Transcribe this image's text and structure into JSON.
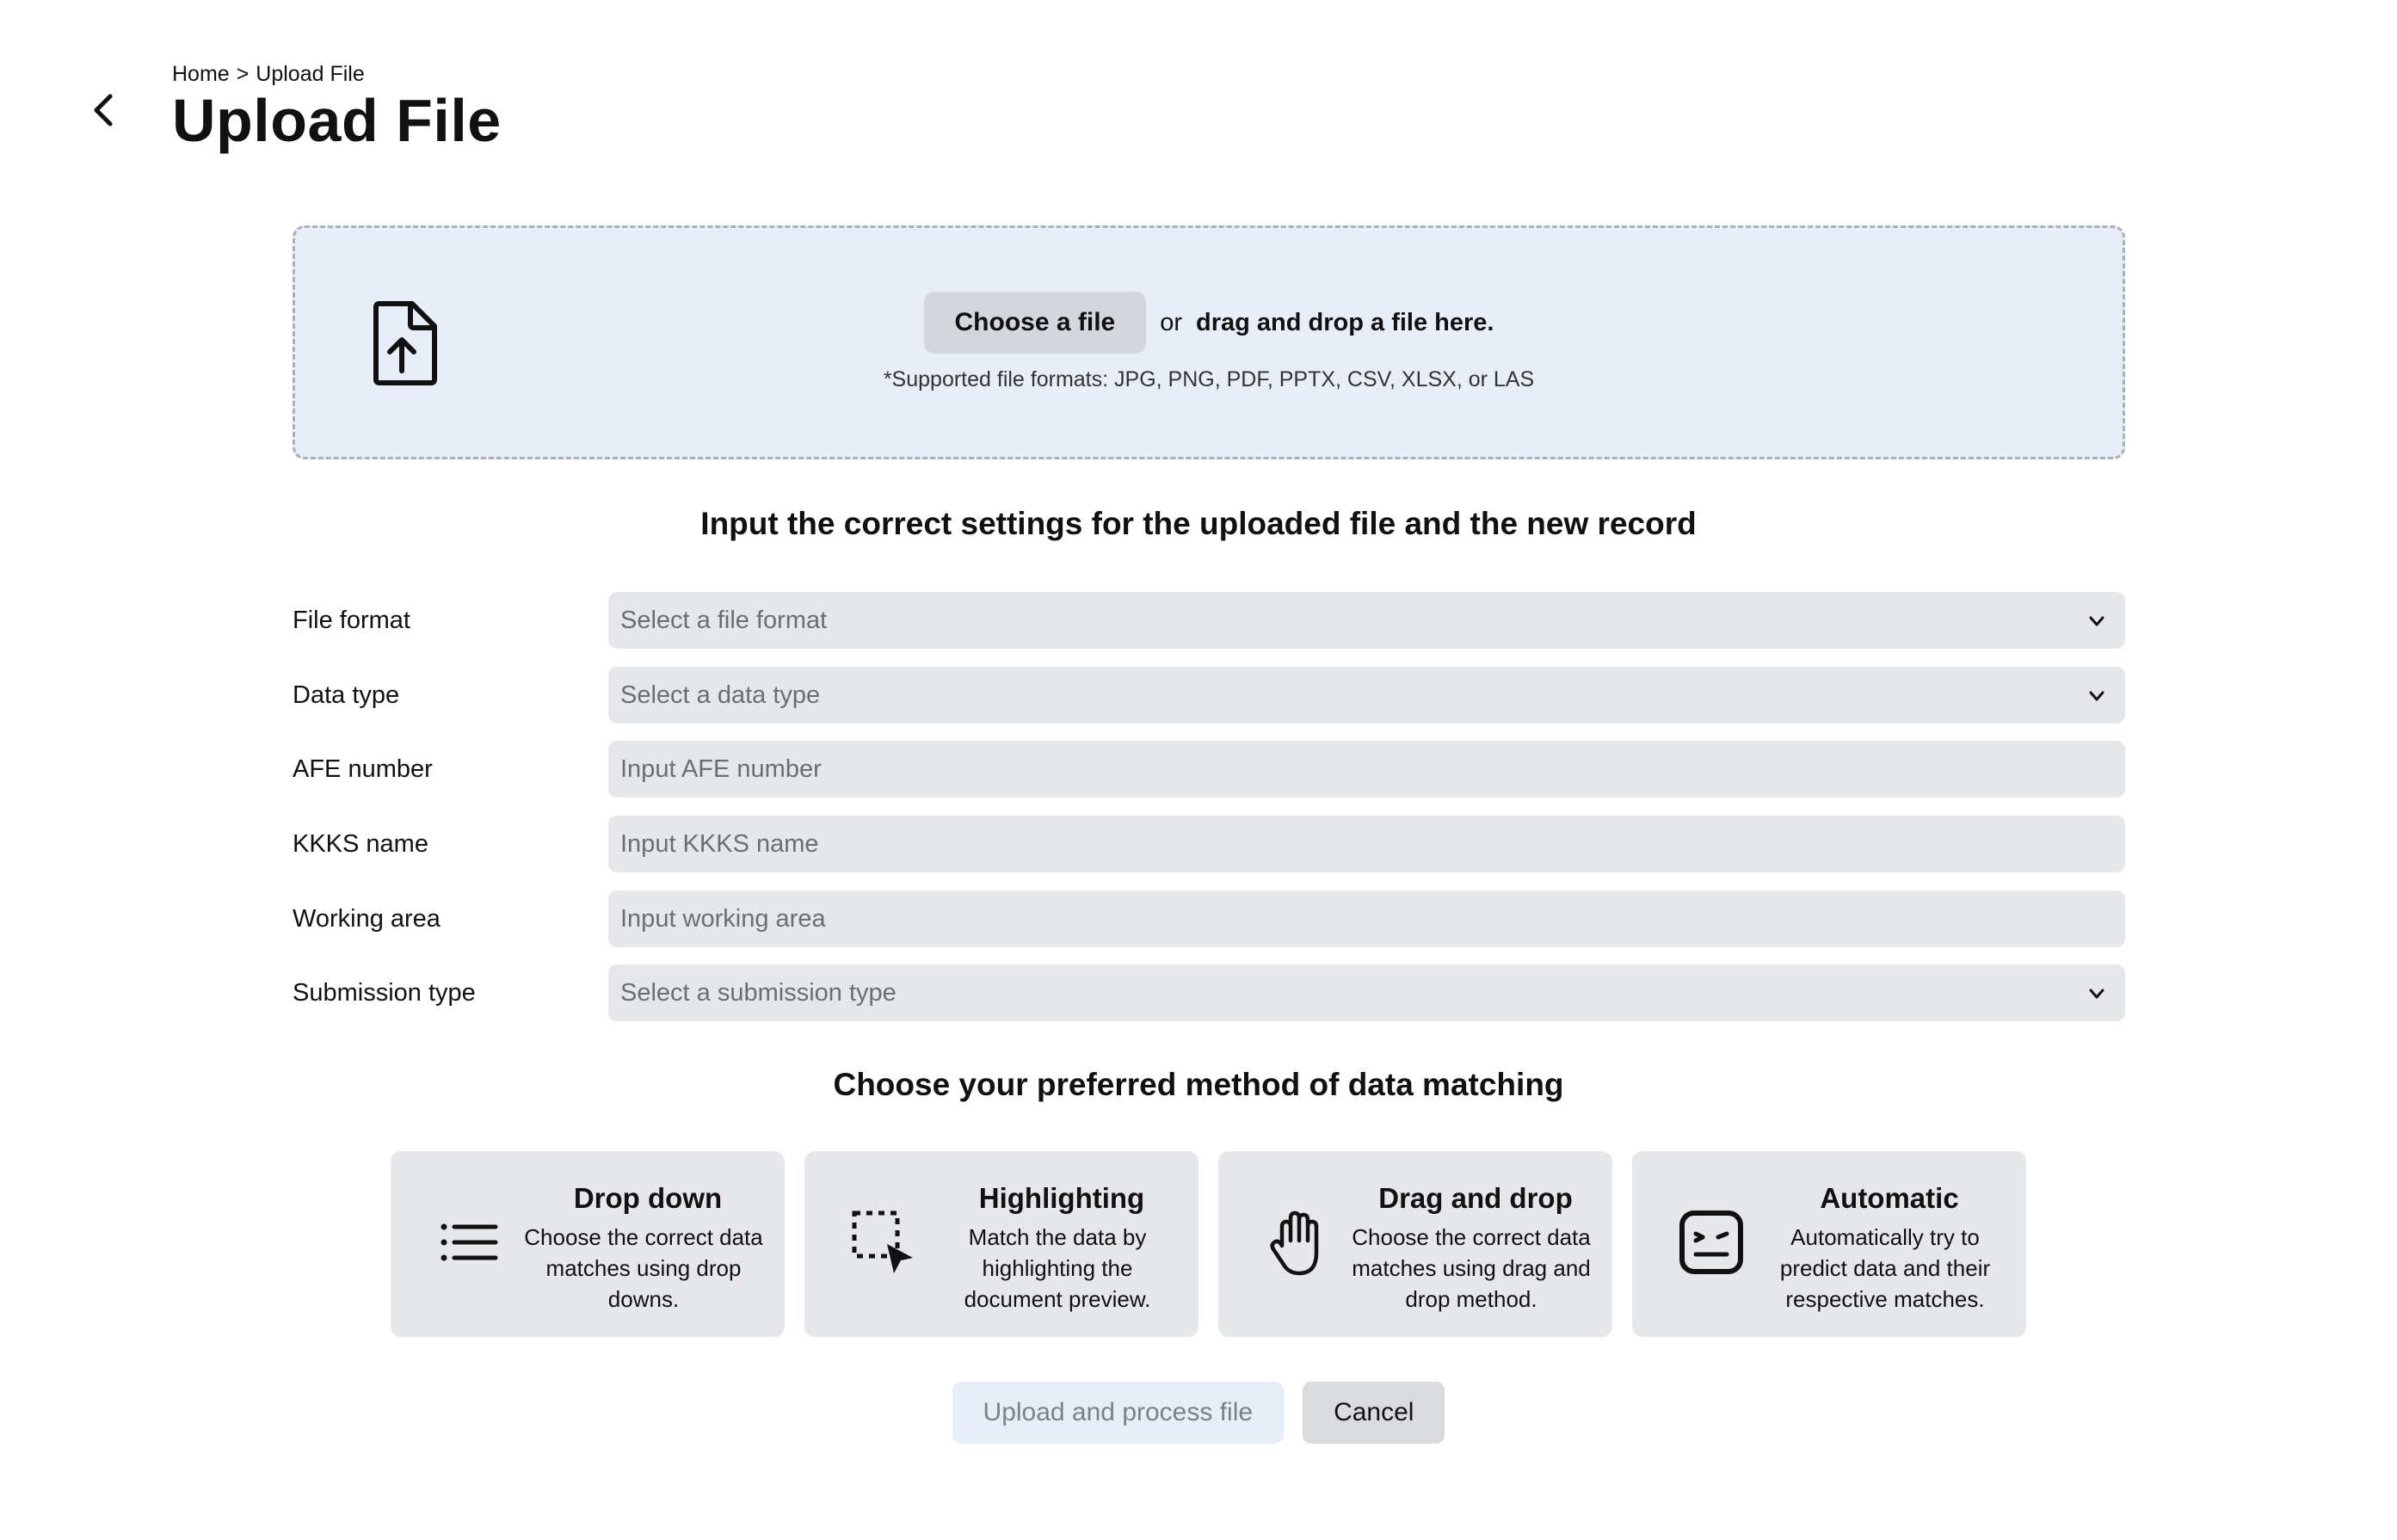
{
  "breadcrumb": {
    "home": "Home",
    "separator": ">",
    "current": "Upload File"
  },
  "page_title": "Upload File",
  "upload": {
    "choose_button": "Choose a file",
    "or_text": "or",
    "drag_text": "drag and drop a file here.",
    "formats_note": "*Supported file formats: JPG, PNG, PDF, PPTX, CSV, XLSX, or LAS"
  },
  "settings": {
    "title": "Input the correct settings for the uploaded file and the new record",
    "fields": [
      {
        "label": "File format",
        "placeholder": "Select a file format",
        "kind": "select"
      },
      {
        "label": "Data type",
        "placeholder": "Select a data type",
        "kind": "select"
      },
      {
        "label": "AFE number",
        "placeholder": "Input AFE number",
        "kind": "input"
      },
      {
        "label": "KKKS name",
        "placeholder": "Input KKKS name",
        "kind": "input"
      },
      {
        "label": "Working area",
        "placeholder": "Input working area",
        "kind": "input"
      },
      {
        "label": "Submission type",
        "placeholder": "Select a submission type",
        "kind": "select"
      }
    ]
  },
  "matching": {
    "title": "Choose your preferred method of data matching",
    "methods": [
      {
        "title": "Drop down",
        "description": "Choose the correct data matches using drop downs.",
        "icon": "list-icon"
      },
      {
        "title": "Highlighting",
        "description": "Match the data by highlighting the document preview.",
        "icon": "selection-cursor-icon"
      },
      {
        "title": "Drag and drop",
        "description": "Choose the correct data matches using drag and drop method.",
        "icon": "hand-icon"
      },
      {
        "title": "Automatic",
        "description": "Automatically try to predict data and their respective matches.",
        "icon": "robot-icon"
      }
    ]
  },
  "actions": {
    "submit": "Upload and process file",
    "cancel": "Cancel"
  },
  "colors": {
    "dropzone_bg": "#e8eef7",
    "field_bg": "#e6e7ea",
    "card_bg": "#e6e7ea",
    "primary_disabled_bg": "#e8eef7",
    "cancel_bg": "#d9dbdf"
  }
}
